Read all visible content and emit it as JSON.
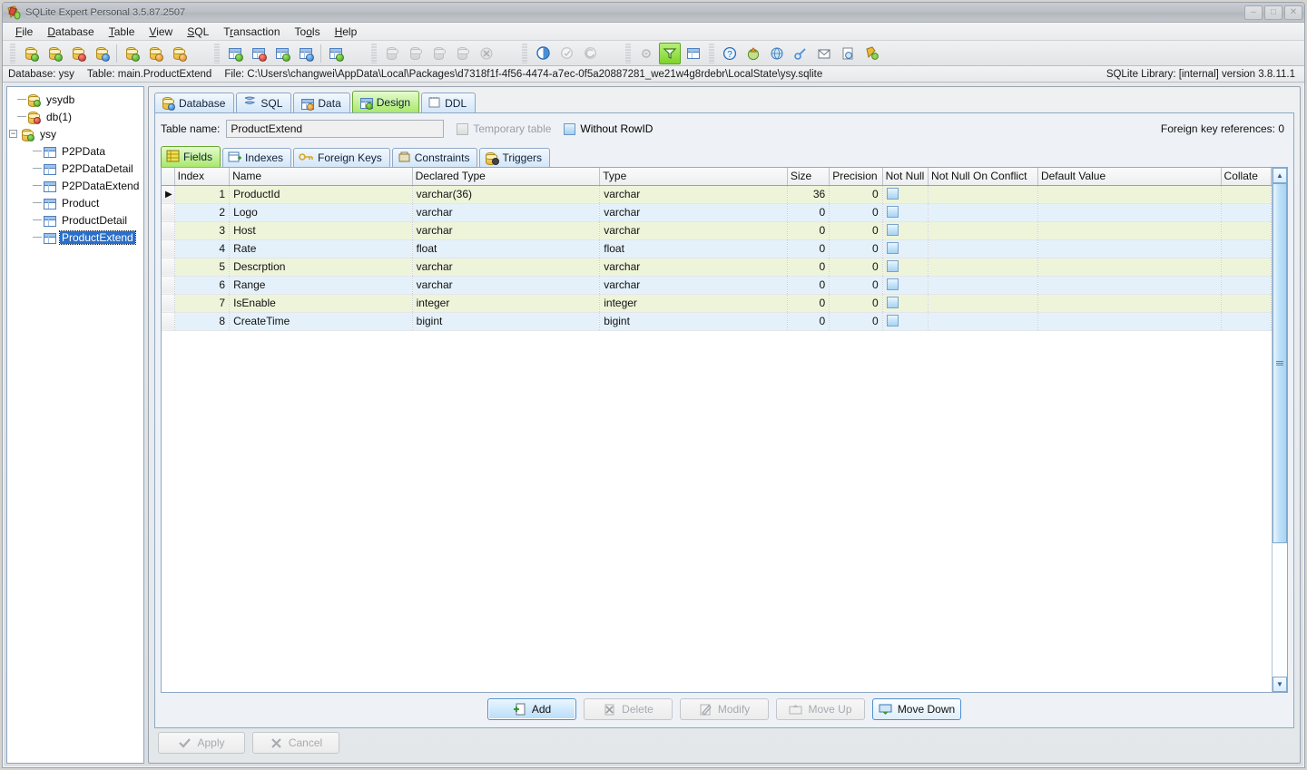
{
  "window": {
    "title": "SQLite Expert Personal 3.5.87.2507",
    "app_icon": "sqlite-expert-icon",
    "controls": {
      "minimize": "–",
      "maximize": "□",
      "close": "✕"
    }
  },
  "menubar": [
    {
      "label": "File",
      "accel": "F"
    },
    {
      "label": "Database",
      "accel": "D"
    },
    {
      "label": "Table",
      "accel": "T"
    },
    {
      "label": "View",
      "accel": "V"
    },
    {
      "label": "SQL",
      "accel": "S"
    },
    {
      "label": "Transaction",
      "accel": "r"
    },
    {
      "label": "Tools",
      "accel": "o"
    },
    {
      "label": "Help",
      "accel": "H"
    }
  ],
  "toolbar": {
    "groups": [
      {
        "name": "database-group",
        "buttons": [
          {
            "name": "open-database-icon",
            "kind": "db",
            "badge": "green",
            "enabled": true
          },
          {
            "name": "new-database-icon",
            "kind": "db",
            "badge": "green-plus",
            "enabled": true
          },
          {
            "name": "close-database-icon",
            "kind": "db",
            "badge": "red",
            "enabled": true
          },
          {
            "name": "database-properties-icon",
            "kind": "db",
            "badge": "blue",
            "enabled": true
          },
          {
            "name": "separator",
            "kind": "sep"
          },
          {
            "name": "attach-database-icon",
            "kind": "db",
            "badge": "green",
            "enabled": true
          },
          {
            "name": "import-database-icon",
            "kind": "db",
            "badge": "orange",
            "enabled": true
          },
          {
            "name": "export-database-icon",
            "kind": "db",
            "badge": "orange",
            "enabled": true
          }
        ]
      },
      {
        "name": "table-group",
        "buttons": [
          {
            "name": "new-table-icon",
            "kind": "grid",
            "badge": "green",
            "enabled": true
          },
          {
            "name": "rename-table-icon",
            "kind": "grid",
            "badge": "red",
            "enabled": true
          },
          {
            "name": "design-table-icon",
            "kind": "grid",
            "badge": "green",
            "enabled": true
          },
          {
            "name": "table-data-icon",
            "kind": "grid",
            "badge": "blue",
            "enabled": true
          },
          {
            "name": "separator",
            "kind": "sep"
          },
          {
            "name": "refresh-table-icon",
            "kind": "grid",
            "badge": "green",
            "enabled": true
          }
        ]
      },
      {
        "name": "record-group",
        "buttons": [
          {
            "name": "add-record-icon",
            "kind": "rec",
            "enabled": false
          },
          {
            "name": "edit-record-icon",
            "kind": "rec",
            "enabled": false
          },
          {
            "name": "delete-record-icon",
            "kind": "rec",
            "enabled": false
          },
          {
            "name": "post-record-icon",
            "kind": "rec",
            "enabled": false
          },
          {
            "name": "cancel-record-icon",
            "kind": "cancel",
            "enabled": false
          }
        ]
      },
      {
        "name": "transaction-group",
        "buttons": [
          {
            "name": "begin-transaction-icon",
            "kind": "circle",
            "enabled": true
          },
          {
            "name": "commit-transaction-icon",
            "kind": "circle",
            "enabled": false
          },
          {
            "name": "rollback-transaction-icon",
            "kind": "circle",
            "enabled": false
          }
        ]
      },
      {
        "name": "view-group",
        "buttons": [
          {
            "name": "options-icon",
            "kind": "gear",
            "enabled": true
          },
          {
            "name": "filter-icon",
            "kind": "funnel",
            "enabled": true,
            "active": true
          },
          {
            "name": "layout-icon",
            "kind": "pane",
            "enabled": true
          }
        ]
      },
      {
        "name": "help-group",
        "buttons": [
          {
            "name": "help-icon",
            "kind": "help",
            "enabled": true
          },
          {
            "name": "home-page-icon",
            "kind": "globe-up",
            "enabled": true
          },
          {
            "name": "check-updates-icon",
            "kind": "globe",
            "enabled": true
          },
          {
            "name": "register-icon",
            "kind": "key",
            "enabled": true
          },
          {
            "name": "feedback-icon",
            "kind": "mail",
            "enabled": true
          },
          {
            "name": "about-icon",
            "kind": "info",
            "enabled": true
          },
          {
            "name": "buy-icon",
            "kind": "cart",
            "enabled": true
          }
        ]
      }
    ]
  },
  "infobar": {
    "database_label": "Database: ysy",
    "table_label": "Table: main.ProductExtend",
    "file_label": "File: C:\\Users\\changwei\\AppData\\Local\\Packages\\d7318f1f-4f56-4474-a7ec-0f5a20887281_we21w4g8rdebr\\LocalState\\ysy.sqlite",
    "library_label": "SQLite Library: [internal] version 3.8.11.1"
  },
  "tree": {
    "nodes": [
      {
        "label": "ysydb",
        "icon": "database-icon",
        "badge": "green",
        "level": 1,
        "expander": "",
        "selected": false
      },
      {
        "label": "db(1)",
        "icon": "database-icon",
        "badge": "red",
        "level": 1,
        "expander": "",
        "selected": false
      },
      {
        "label": "ysy",
        "icon": "database-icon",
        "badge": "green",
        "level": 0,
        "expander": "−",
        "selected": false
      },
      {
        "label": "P2PData",
        "icon": "table-icon",
        "level": 2,
        "expander": "",
        "selected": false
      },
      {
        "label": "P2PDataDetail",
        "icon": "table-icon",
        "level": 2,
        "expander": "",
        "selected": false
      },
      {
        "label": "P2PDataExtend",
        "icon": "table-icon",
        "level": 2,
        "expander": "",
        "selected": false
      },
      {
        "label": "Product",
        "icon": "table-icon",
        "level": 2,
        "expander": "",
        "selected": false
      },
      {
        "label": "ProductDetail",
        "icon": "table-icon",
        "level": 2,
        "expander": "",
        "selected": false
      },
      {
        "label": "ProductExtend",
        "icon": "table-icon",
        "level": 2,
        "expander": "",
        "selected": true
      }
    ]
  },
  "main_tabs": [
    {
      "label": "Database",
      "icon": "database-icon",
      "active": false
    },
    {
      "label": "SQL",
      "icon": "sql-icon",
      "active": false
    },
    {
      "label": "Data",
      "icon": "data-grid-icon",
      "active": false
    },
    {
      "label": "Design",
      "icon": "design-icon",
      "active": true
    },
    {
      "label": "DDL",
      "icon": "ddl-icon",
      "active": false
    }
  ],
  "design": {
    "table_name_label": "Table name:",
    "table_name_value": "ProductExtend",
    "temporary_table_label": "Temporary table",
    "temporary_table_checked": false,
    "temporary_table_enabled": false,
    "without_rowid_label": "Without RowID",
    "without_rowid_checked": false,
    "without_rowid_enabled": true,
    "foreign_key_references": "Foreign key references: 0"
  },
  "sub_tabs": [
    {
      "label": "Fields",
      "icon": "fields-icon",
      "active": true
    },
    {
      "label": "Indexes",
      "icon": "indexes-icon",
      "active": false
    },
    {
      "label": "Foreign Keys",
      "icon": "foreign-keys-icon",
      "active": false
    },
    {
      "label": "Constraints",
      "icon": "constraints-icon",
      "active": false
    },
    {
      "label": "Triggers",
      "icon": "triggers-icon",
      "active": false
    }
  ],
  "grid": {
    "columns": [
      "Index",
      "Name",
      "Declared Type",
      "Type",
      "Size",
      "Precision",
      "Not Null",
      "Not Null On Conflict",
      "Default Value",
      "Collate"
    ],
    "rows": [
      {
        "index": "1",
        "name": "ProductId",
        "declared_type": "varchar(36)",
        "type": "varchar",
        "size": "36",
        "precision": "0",
        "not_null": false,
        "not_null_on_conflict": "",
        "default_value": "",
        "collate": "",
        "current": true
      },
      {
        "index": "2",
        "name": "Logo",
        "declared_type": "varchar",
        "type": "varchar",
        "size": "0",
        "precision": "0",
        "not_null": false,
        "not_null_on_conflict": "",
        "default_value": "",
        "collate": "",
        "current": false
      },
      {
        "index": "3",
        "name": "Host",
        "declared_type": "varchar",
        "type": "varchar",
        "size": "0",
        "precision": "0",
        "not_null": false,
        "not_null_on_conflict": "",
        "default_value": "",
        "collate": "",
        "current": false
      },
      {
        "index": "4",
        "name": "Rate",
        "declared_type": "float",
        "type": "float",
        "size": "0",
        "precision": "0",
        "not_null": false,
        "not_null_on_conflict": "",
        "default_value": "",
        "collate": "",
        "current": false
      },
      {
        "index": "5",
        "name": "Descrption",
        "declared_type": "varchar",
        "type": "varchar",
        "size": "0",
        "precision": "0",
        "not_null": false,
        "not_null_on_conflict": "",
        "default_value": "",
        "collate": "",
        "current": false
      },
      {
        "index": "6",
        "name": "Range",
        "declared_type": "varchar",
        "type": "varchar",
        "size": "0",
        "precision": "0",
        "not_null": false,
        "not_null_on_conflict": "",
        "default_value": "",
        "collate": "",
        "current": false
      },
      {
        "index": "7",
        "name": "IsEnable",
        "declared_type": "integer",
        "type": "integer",
        "size": "0",
        "precision": "0",
        "not_null": false,
        "not_null_on_conflict": "",
        "default_value": "",
        "collate": "",
        "current": false
      },
      {
        "index": "8",
        "name": "CreateTime",
        "declared_type": "bigint",
        "type": "bigint",
        "size": "0",
        "precision": "0",
        "not_null": false,
        "not_null_on_conflict": "",
        "default_value": "",
        "collate": "",
        "current": false
      }
    ],
    "scrollbar": {
      "up_arrow": "▲",
      "down_arrow": "▼",
      "thumb_percent": 73
    }
  },
  "field_buttons": [
    {
      "label": "Add",
      "icon": "add-field-icon",
      "enabled": true,
      "focused": true
    },
    {
      "label": "Delete",
      "icon": "delete-field-icon",
      "enabled": false,
      "focused": false
    },
    {
      "label": "Modify",
      "icon": "modify-field-icon",
      "enabled": false,
      "focused": false
    },
    {
      "label": "Move Up",
      "icon": "move-up-icon",
      "enabled": false,
      "focused": false
    },
    {
      "label": "Move Down",
      "icon": "move-down-icon",
      "enabled": true,
      "focused": false
    }
  ],
  "commit_buttons": [
    {
      "label": "Apply",
      "icon": "check-icon",
      "enabled": false
    },
    {
      "label": "Cancel",
      "icon": "cross-icon",
      "enabled": false
    }
  ]
}
